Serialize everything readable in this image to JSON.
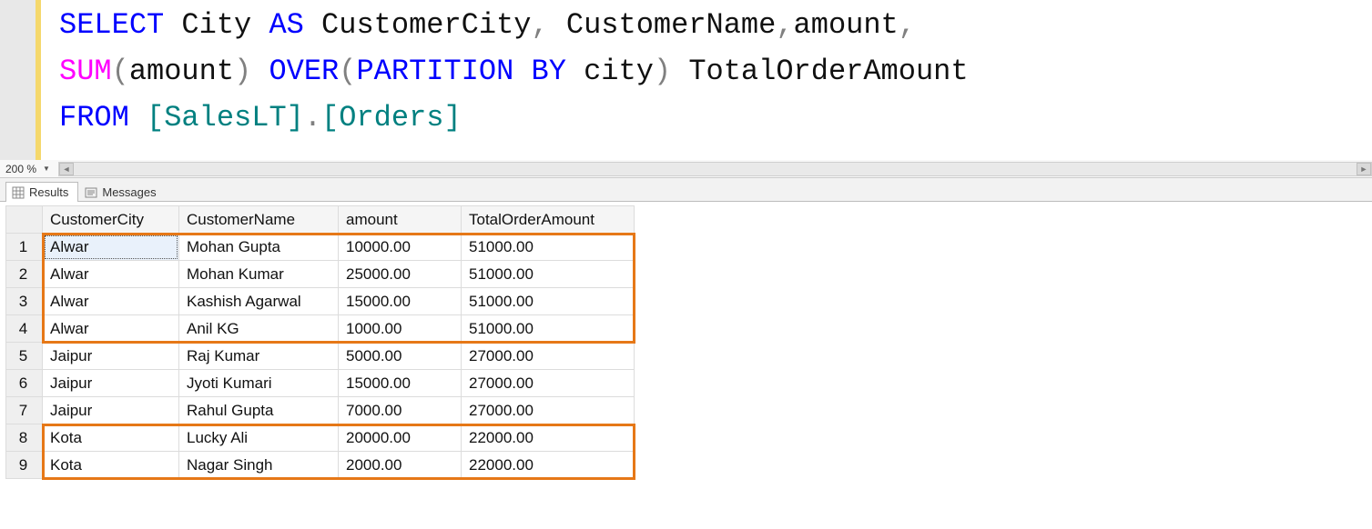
{
  "editor": {
    "tokens": [
      [
        {
          "t": "SELECT",
          "c": "kw"
        },
        {
          "t": " ",
          "c": "id"
        },
        {
          "t": "City",
          "c": "id"
        },
        {
          "t": " ",
          "c": "id"
        },
        {
          "t": "AS",
          "c": "kw"
        },
        {
          "t": " ",
          "c": "id"
        },
        {
          "t": "CustomerCity",
          "c": "id"
        },
        {
          "t": ",",
          "c": "op"
        },
        {
          "t": " ",
          "c": "id"
        },
        {
          "t": "CustomerName",
          "c": "id"
        },
        {
          "t": ",",
          "c": "op"
        },
        {
          "t": "amount",
          "c": "id"
        },
        {
          "t": ",",
          "c": "op"
        }
      ],
      [
        {
          "t": "SUM",
          "c": "fn"
        },
        {
          "t": "(",
          "c": "op"
        },
        {
          "t": "amount",
          "c": "id"
        },
        {
          "t": ")",
          "c": "op"
        },
        {
          "t": " ",
          "c": "id"
        },
        {
          "t": "OVER",
          "c": "kw"
        },
        {
          "t": "(",
          "c": "op"
        },
        {
          "t": "PARTITION",
          "c": "kw"
        },
        {
          "t": " ",
          "c": "id"
        },
        {
          "t": "BY",
          "c": "kw"
        },
        {
          "t": " ",
          "c": "id"
        },
        {
          "t": "city",
          "c": "id"
        },
        {
          "t": ")",
          "c": "op"
        },
        {
          "t": " ",
          "c": "id"
        },
        {
          "t": "TotalOrderAmount",
          "c": "id"
        }
      ],
      [
        {
          "t": "FROM",
          "c": "kw"
        },
        {
          "t": " ",
          "c": "id"
        },
        {
          "t": "[SalesLT]",
          "c": "bracket-id"
        },
        {
          "t": ".",
          "c": "op"
        },
        {
          "t": "[Orders]",
          "c": "bracket-id"
        }
      ]
    ]
  },
  "zoom": {
    "value": "200 %"
  },
  "tabs": {
    "results": "Results",
    "messages": "Messages"
  },
  "grid": {
    "columns": [
      "CustomerCity",
      "CustomerName",
      "amount",
      "TotalOrderAmount"
    ],
    "rows": [
      {
        "n": "1",
        "city": "Alwar",
        "name": "Mohan Gupta",
        "amount": "10000.00",
        "total": "51000.00"
      },
      {
        "n": "2",
        "city": "Alwar",
        "name": "Mohan Kumar",
        "amount": "25000.00",
        "total": "51000.00"
      },
      {
        "n": "3",
        "city": "Alwar",
        "name": "Kashish Agarwal",
        "amount": "15000.00",
        "total": "51000.00"
      },
      {
        "n": "4",
        "city": "Alwar",
        "name": "Anil KG",
        "amount": "1000.00",
        "total": "51000.00"
      },
      {
        "n": "5",
        "city": "Jaipur",
        "name": "Raj Kumar",
        "amount": "5000.00",
        "total": "27000.00"
      },
      {
        "n": "6",
        "city": "Jaipur",
        "name": "Jyoti Kumari",
        "amount": "15000.00",
        "total": "27000.00"
      },
      {
        "n": "7",
        "city": "Jaipur",
        "name": "Rahul Gupta",
        "amount": "7000.00",
        "total": "27000.00"
      },
      {
        "n": "8",
        "city": "Kota",
        "name": "Lucky Ali",
        "amount": "20000.00",
        "total": "22000.00"
      },
      {
        "n": "9",
        "city": "Kota",
        "name": "Nagar Singh",
        "amount": "2000.00",
        "total": "22000.00"
      }
    ]
  }
}
